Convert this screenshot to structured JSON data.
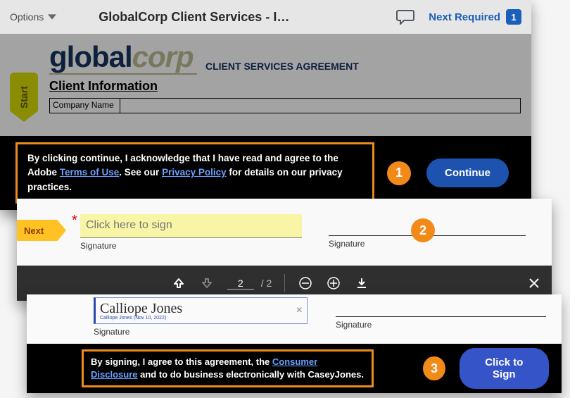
{
  "header": {
    "options_label": "Options",
    "doc_title": "GlobalCorp Client Services - I…",
    "next_required_label": "Next Required",
    "next_required_count": "1"
  },
  "doc": {
    "start_label": "Start",
    "logo_a": "global",
    "logo_b": "corp",
    "agreement_title": "CLIENT SERVICES AGREEMENT",
    "section_title": "Client Information",
    "company_label": "Company Name"
  },
  "consent1": {
    "text_a": "By clicking continue, I acknowledge that I have read and agree to the Adobe ",
    "terms_link": "Terms of Use",
    "text_b": ". See our ",
    "privacy_link": "Privacy Policy",
    "text_c": " for details on our privacy practices.",
    "continue_label": "Continue",
    "callout": "1"
  },
  "panel2": {
    "next_label": "Next",
    "placeholder": "Click here to sign",
    "sig_label_left": "Signature",
    "sig_label_right": "Signature",
    "callout": "2",
    "page_current": "2",
    "page_total": "/ 2"
  },
  "panel3": {
    "signed_name": "Calliope Jones",
    "signed_meta": "Calliope Jones  (Nov 10, 2022)",
    "sig_label_left": "Signature",
    "sig_label_right": "Signature",
    "consent_a": "By signing, I agree to this agreement, the ",
    "consent_link": "Consumer Disclosure",
    "consent_b": " and to do business electronically with CaseyJones.",
    "callout": "3",
    "sign_label": "Click to Sign"
  }
}
